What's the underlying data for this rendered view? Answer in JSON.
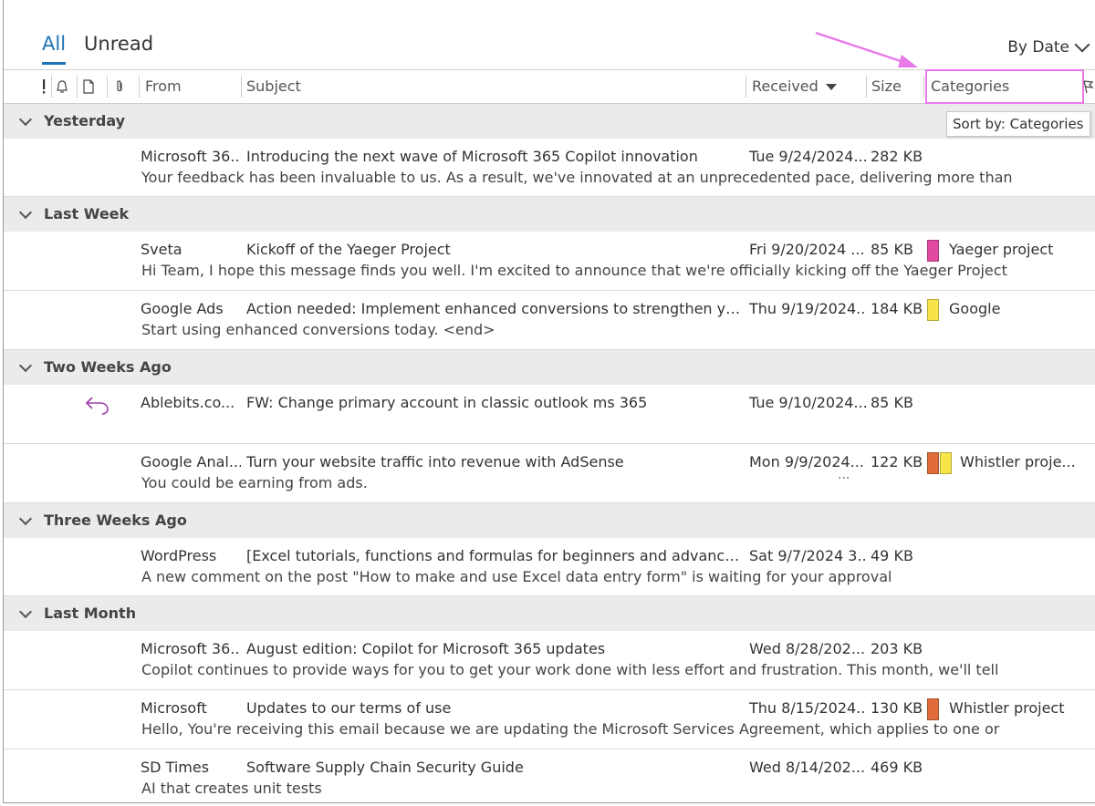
{
  "filters": {
    "all": "All",
    "unread": "Unread",
    "sort": "By Date"
  },
  "columns": {
    "from": "From",
    "subject": "Subject",
    "received": "Received",
    "size": "Size",
    "categories": "Categories"
  },
  "tooltip": "Sort by: Categories",
  "groups": {
    "yesterday": "Yesterday",
    "last_week": "Last Week",
    "two_weeks": "Two Weeks Ago",
    "three_weeks": "Three Weeks Ago",
    "last_month": "Last Month"
  },
  "colors": {
    "pink": "#e04aa0",
    "yellow": "#f6e44a",
    "orange": "#e06c3c",
    "accent": "#1f73b7",
    "annotation": "#e87ae8"
  },
  "messages": [
    {
      "from": "Microsoft 36...",
      "subject": "Introducing the next wave of Microsoft 365 Copilot innovation",
      "received": "Tue 9/24/2024...",
      "size": "282 KB",
      "category": "",
      "preview": "Your feedback has been invaluable to us. As a result, we've innovated at an unprecedented pace, delivering more than"
    },
    {
      "from": "Sveta",
      "subject": "Kickoff of the Yaeger Project",
      "received": "Fri 9/20/2024 ...",
      "size": "85 KB",
      "category": "Yaeger project",
      "preview": "Hi Team,  I hope this message finds you well. I'm excited to announce that we're officially kicking off the Yaeger Project"
    },
    {
      "from": "Google Ads",
      "subject": "Action needed: Implement enhanced conversions to strengthen yo...",
      "received": "Thu 9/19/2024...",
      "size": "184 KB",
      "category": "Google",
      "preview": "Start using enhanced conversions today. <end>"
    },
    {
      "from": "Ablebits.co...",
      "subject": "FW: Change primary account in classic outlook ms 365",
      "received": "Tue 9/10/2024...",
      "size": "85 KB",
      "category": "",
      "preview": ""
    },
    {
      "from": "Google Anal...",
      "subject": "Turn your website traffic into revenue with AdSense",
      "received": "Mon 9/9/2024...",
      "size": "122 KB",
      "category": "Whistler proje...",
      "preview": "You could be earning from ads.",
      "extra": "..."
    },
    {
      "from": "WordPress",
      "subject": "[Excel tutorials, functions and formulas for beginners and advance...",
      "received": "Sat 9/7/2024 3...",
      "size": "49 KB",
      "category": "",
      "preview": "A new comment on the post \"How to make and use Excel data entry form\" is waiting for your approval"
    },
    {
      "from": "Microsoft 36...",
      "subject": "August edition: Copilot for Microsoft 365 updates",
      "received": "Wed 8/28/202...",
      "size": "203 KB",
      "category": "",
      "preview": "Copilot continues to provide ways for you to get your work done with less effort and frustration. This month, we'll tell"
    },
    {
      "from": "Microsoft",
      "subject": "Updates to our terms of use",
      "received": "Thu 8/15/2024...",
      "size": "130 KB",
      "category": "Whistler project",
      "preview": "Hello, You're receiving this email because we are updating the Microsoft Services Agreement, which applies to one or"
    },
    {
      "from": "SD Times",
      "subject": "Software Supply Chain Security Guide",
      "received": "Wed 8/14/202...",
      "size": "469 KB",
      "category": "",
      "preview": "AI that creates unit tests"
    }
  ]
}
